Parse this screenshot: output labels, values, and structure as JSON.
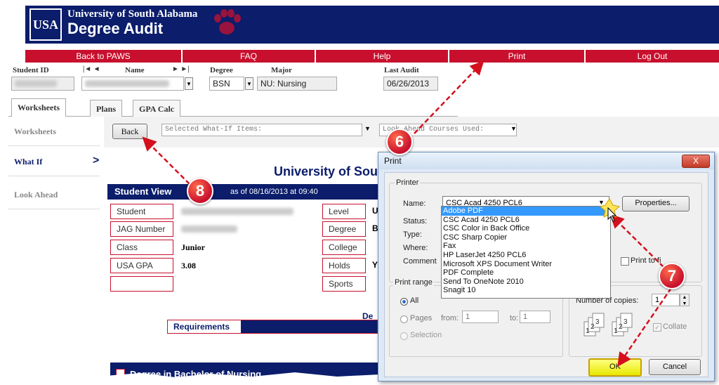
{
  "header": {
    "logo_text": "USA",
    "university": "University of South Alabama",
    "app_title": "Degree Audit"
  },
  "nav": [
    "Back to PAWS",
    "FAQ",
    "Help",
    "Print",
    "Log Out"
  ],
  "student_bar": {
    "student_id_label": "Student ID",
    "name_label": "Name",
    "degree_label": "Degree",
    "degree_value": "BSN",
    "major_label": "Major",
    "major_value": "NU: Nursing",
    "last_audit_label": "Last Audit",
    "last_audit_value": "06/26/2013",
    "nav_first": "|◄ ◄",
    "nav_last": "► ►|"
  },
  "tabs": [
    "Worksheets",
    "Plans",
    "GPA Calc"
  ],
  "sidebar": [
    "Worksheets",
    "What If",
    "Look Ahead"
  ],
  "toolbar": {
    "back_label": "Back",
    "whatif_select": "Selected What-If Items:",
    "lookahead_select": "Look Ahead Courses Used:"
  },
  "report": {
    "title": "University of Sou",
    "student_view": "Student View",
    "as_of": "as of 08/16/2013 at 09:40",
    "rows": [
      {
        "label": "Student",
        "value": "",
        "label2": "Level",
        "value2": "U"
      },
      {
        "label": "JAG Number",
        "value": "",
        "label2": "Degree",
        "value2": "B"
      },
      {
        "label": "Class",
        "value": "Junior",
        "label2": "College",
        "value2": ""
      },
      {
        "label": "USA GPA",
        "value": "3.08",
        "label2": "Holds",
        "value2": "Y"
      },
      {
        "label": "",
        "value": "",
        "label2": "Sports",
        "value2": ""
      }
    ],
    "de_text": "De",
    "requirements": "Requirements",
    "degree_section": "Degree in Bachelor of Nursing"
  },
  "print_dialog": {
    "title": "Print",
    "close": "X",
    "printer_group": "Printer",
    "name_label": "Name:",
    "selected_printer": "CSC Acad 4250 PCL6",
    "properties": "Properties...",
    "status_label": "Status:",
    "type_label": "Type:",
    "where_label": "Where:",
    "comment_label": "Comment",
    "print_to_file": "Print to fi",
    "printers": [
      "Adobe PDF",
      "CSC Acad 4250 PCL6",
      "CSC Color in Back Office",
      "CSC Sharp Copier",
      "Fax",
      "HP LaserJet 4250 PCL6",
      "Microsoft XPS Document Writer",
      "PDF Complete",
      "Send To OneNote 2010",
      "Snagit 10"
    ],
    "print_range": "Print range",
    "all": "All",
    "pages": "Pages",
    "from_label": "from:",
    "from_value": "1",
    "to_label": "to:",
    "to_value": "1",
    "selection": "Selection",
    "copies_label": "Number of copies:",
    "copies_value": "1",
    "collate": "Collate",
    "ok": "OK",
    "cancel": "Cancel"
  },
  "markers": [
    "6",
    "7",
    "8"
  ],
  "colors": {
    "navy": "#0b1d6b",
    "red": "#c8102e",
    "arrow": "#d4101e",
    "ok_yellow": "#e8e800"
  }
}
